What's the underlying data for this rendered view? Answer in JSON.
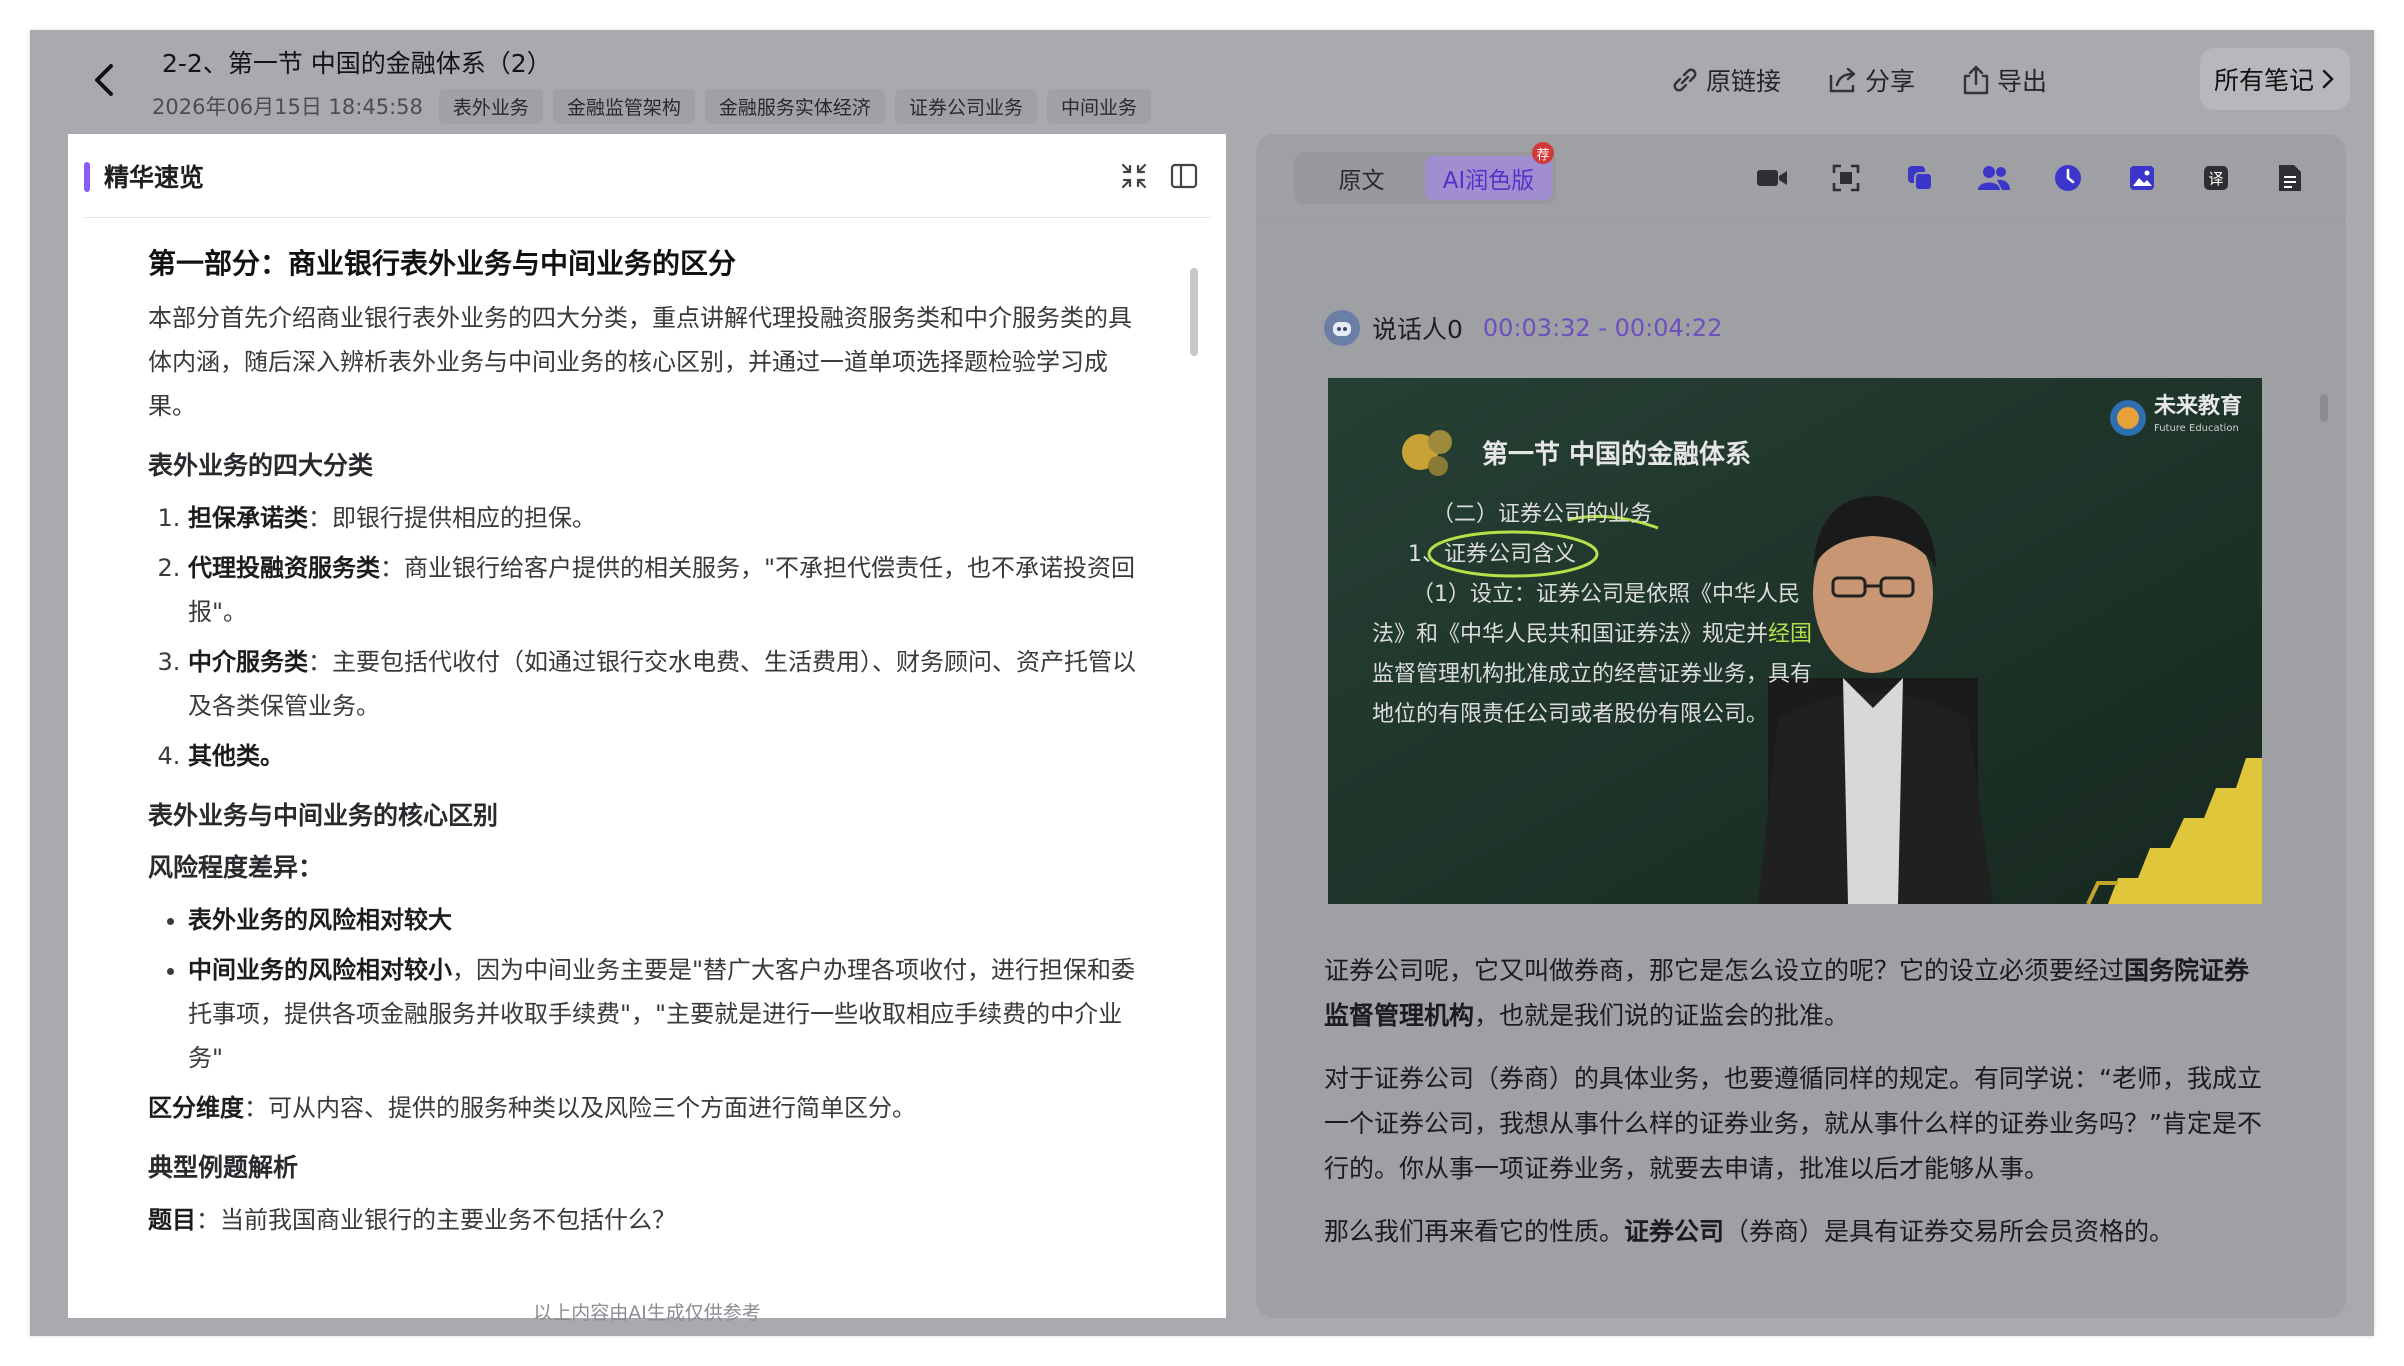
{
  "header": {
    "title": "2-2、第一节 中国的金融体系（2）",
    "date": "2026年06月15日 18:45:58",
    "tags": [
      "表外业务",
      "金融监管架构",
      "金融服务实体经济",
      "证券公司业务",
      "中间业务"
    ],
    "actions": {
      "link": "原链接",
      "share": "分享",
      "export": "导出"
    },
    "all_notes": "所有笔记"
  },
  "left_panel": {
    "title": "精华速览",
    "section_title": "第一部分：商业银行表外业务与中间业务的区分",
    "intro": "本部分首先介绍商业银行表外业务的四大分类，重点讲解代理投融资服务类和中介服务类的具体内涵，随后深入辨析表外业务与中间业务的核心区别，并通过一道单项选择题检验学习成果。",
    "h_four": "表外业务的四大分类",
    "four_items": [
      {
        "term": "担保承诺类",
        "desc": "：即银行提供相应的担保。"
      },
      {
        "term": "代理投融资服务类",
        "desc": "：商业银行给客户提供的相关服务，\"不承担代偿责任，也不承诺投资回报\"。"
      },
      {
        "term": "中介服务类",
        "desc": "：主要包括代收付（如通过银行交水电费、生活费用）、财务顾问、资产托管以及各类保管业务。"
      },
      {
        "term": "其他类。",
        "desc": ""
      }
    ],
    "h_diff": "表外业务与中间业务的核心区别",
    "h_risk": "风险程度差异：",
    "risk_items": [
      {
        "term": "表外业务的风险相对较大",
        "desc": ""
      },
      {
        "term": "中间业务的风险相对较小",
        "desc": "，因为中间业务主要是\"替广大客户办理各项收付，进行担保和委托事项，提供各项金融服务并收取手续费\"，\"主要就是进行一些收取相应手续费的中介业务\""
      }
    ],
    "dim_term": "区分维度",
    "dim_desc": "：可从内容、提供的服务种类以及风险三个方面进行简单区分。",
    "h_example": "典型例题解析",
    "question_term": "题目",
    "question_desc": "：当前我国商业银行的主要业务不包括什么？",
    "footer": "以上内容由AI生成仅供参考"
  },
  "right_panel": {
    "tabs": [
      "原文",
      "AI润色版"
    ],
    "badge": "荐",
    "speaker": "说话人0",
    "time_range": "00:03:32 - 00:04:22",
    "video": {
      "logo": "未来教育",
      "logo_sub": "Future Education",
      "slide_title": "第一节 中国的金融体系",
      "line1": "（二）证券公司的业务",
      "line2": "1、证券公司含义",
      "line3": "（1）设立：证券公司是依照《中华人民",
      "line4a": "法》和《中华人民共和国证券法》规定并",
      "line4b": "经国",
      "line5": "监督管理机构批准成立的经营证券业务，具有",
      "line6": "地位的有限责任公司或者股份有限公司。"
    },
    "transcript": [
      {
        "pre": "证券公司呢，它又叫做券商，那它是怎么设立的呢？它的设立必须要经过",
        "bold": "国务院证券监督管理机构",
        "post": "，也就是我们说的证监会的批准。"
      },
      {
        "pre": "对于证券公司（券商）的具体业务，也要遵循同样的规定。有同学说：“老师，我成立一个证券公司，我想从事什么样的证券业务，就从事什么样的证券业务吗？”肯定是不行的。你从事一项证券业务，就要去申请，批准以后才能够从事。",
        "bold": "",
        "post": ""
      },
      {
        "pre": "那么我们再来看它的性质。",
        "bold": "证券公司",
        "post": "（券商）是具有证券交易所会员资格的。"
      }
    ]
  },
  "colors": {
    "accent": "#8a5cf6",
    "time": "#6d4fc0",
    "overlay": "#a9aaaf"
  }
}
